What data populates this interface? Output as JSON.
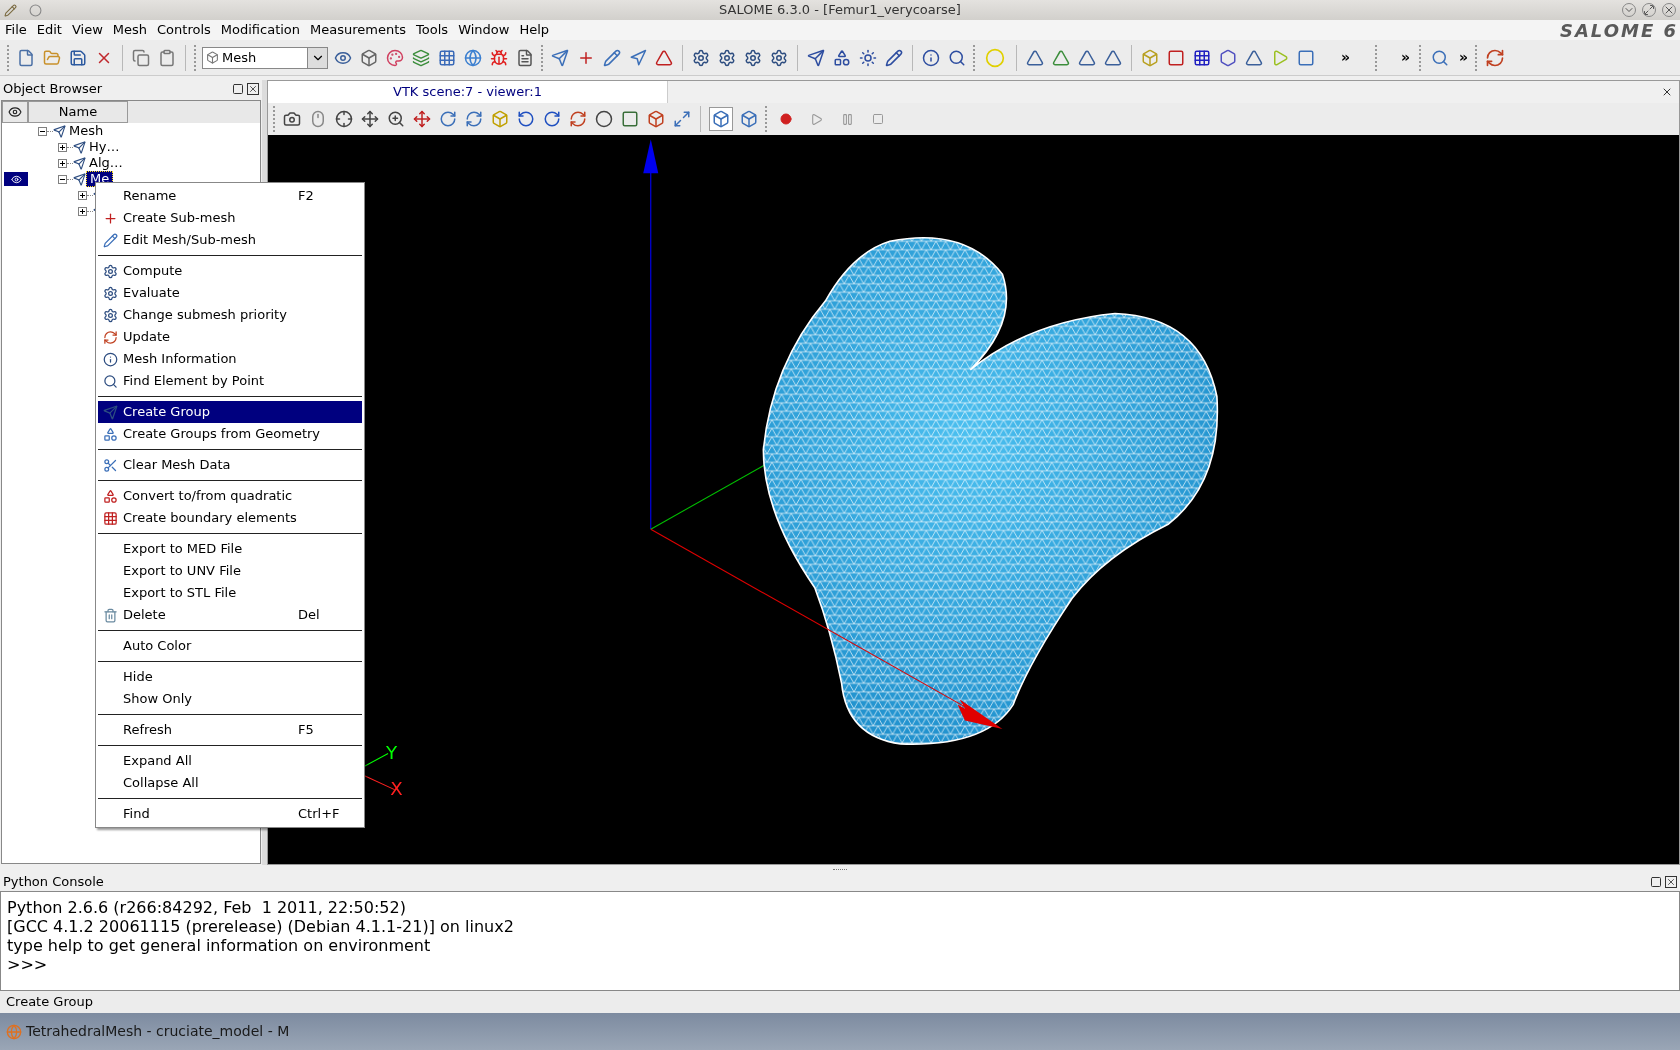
{
  "window": {
    "title": "SALOME 6.3.0 - [Femur1_verycoarse]"
  },
  "menu_bar": [
    "File",
    "Edit",
    "View",
    "Mesh",
    "Controls",
    "Modification",
    "Measurements",
    "Tools",
    "Window",
    "Help"
  ],
  "logo": "SALOME 6",
  "toolbar": {
    "module": "Mesh",
    "overflow": [
      "»",
      "»",
      "»"
    ]
  },
  "object_browser": {
    "title": "Object Browser",
    "column": "Name",
    "tree": [
      {
        "label": "Mesh",
        "expanded": true,
        "selected": false,
        "children": [
          {
            "label": "Hy…",
            "expanded": false,
            "selected": false
          },
          {
            "label": "Alg…",
            "expanded": false,
            "selected": false
          },
          {
            "label": "Me",
            "expanded": true,
            "selected": true,
            "children": [
              {
                "expanded": false,
                "selected": false
              },
              {
                "expanded": false,
                "selected": false
              }
            ]
          }
        ]
      }
    ]
  },
  "viewer": {
    "title": "VTK scene:7 - viewer:1",
    "triad": [
      "Y",
      "X"
    ]
  },
  "context_menu": [
    {
      "kind": "item",
      "label": "Rename",
      "shortcut": "F2",
      "selected": false
    },
    {
      "kind": "item",
      "label": "Create Sub-mesh",
      "selected": false
    },
    {
      "kind": "item",
      "label": "Edit Mesh/Sub-mesh",
      "selected": false
    },
    {
      "kind": "separator"
    },
    {
      "kind": "item",
      "label": "Compute",
      "selected": false
    },
    {
      "kind": "item",
      "label": "Evaluate",
      "selected": false
    },
    {
      "kind": "item",
      "label": "Change submesh priority",
      "selected": false
    },
    {
      "kind": "item",
      "label": "Update",
      "selected": false
    },
    {
      "kind": "item",
      "label": "Mesh Information",
      "selected": false
    },
    {
      "kind": "item",
      "label": "Find Element by Point",
      "selected": false
    },
    {
      "kind": "separator"
    },
    {
      "kind": "item",
      "label": "Create Group",
      "selected": true
    },
    {
      "kind": "item",
      "label": "Create Groups from Geometry",
      "selected": false
    },
    {
      "kind": "separator"
    },
    {
      "kind": "item",
      "label": "Clear Mesh Data",
      "selected": false
    },
    {
      "kind": "separator"
    },
    {
      "kind": "item",
      "label": "Convert to/from quadratic",
      "selected": false
    },
    {
      "kind": "item",
      "label": "Create boundary elements",
      "selected": false
    },
    {
      "kind": "separator"
    },
    {
      "kind": "item",
      "label": "Export to MED File",
      "selected": false
    },
    {
      "kind": "item",
      "label": "Export to UNV File",
      "selected": false
    },
    {
      "kind": "item",
      "label": "Export to STL File",
      "selected": false
    },
    {
      "kind": "item",
      "label": "Delete",
      "shortcut": "Del",
      "selected": false
    },
    {
      "kind": "separator"
    },
    {
      "kind": "item",
      "label": "Auto Color",
      "selected": false
    },
    {
      "kind": "separator"
    },
    {
      "kind": "item",
      "label": "Hide",
      "selected": false
    },
    {
      "kind": "item",
      "label": "Show Only",
      "selected": false
    },
    {
      "kind": "separator"
    },
    {
      "kind": "item",
      "label": "Refresh",
      "shortcut": "F5",
      "selected": false
    },
    {
      "kind": "separator"
    },
    {
      "kind": "item",
      "label": "Expand All",
      "selected": false
    },
    {
      "kind": "item",
      "label": "Collapse All",
      "selected": false
    },
    {
      "kind": "separator"
    },
    {
      "kind": "item",
      "label": "Find",
      "shortcut": "Ctrl+F",
      "selected": false
    }
  ],
  "python_console": {
    "title": "Python Console",
    "lines": [
      "Python 2.6.6 (r266:84292, Feb  1 2011, 22:50:52)",
      "[GCC 4.1.2 20061115 (prerelease) (Debian 4.1.1-21)] on linux2",
      "type help to get general information on environment",
      ">>>"
    ]
  },
  "status_bar": "Create Group",
  "taskbar": [
    {
      "label": "TetrahedralMesh - cruciate_model - M"
    }
  ]
}
